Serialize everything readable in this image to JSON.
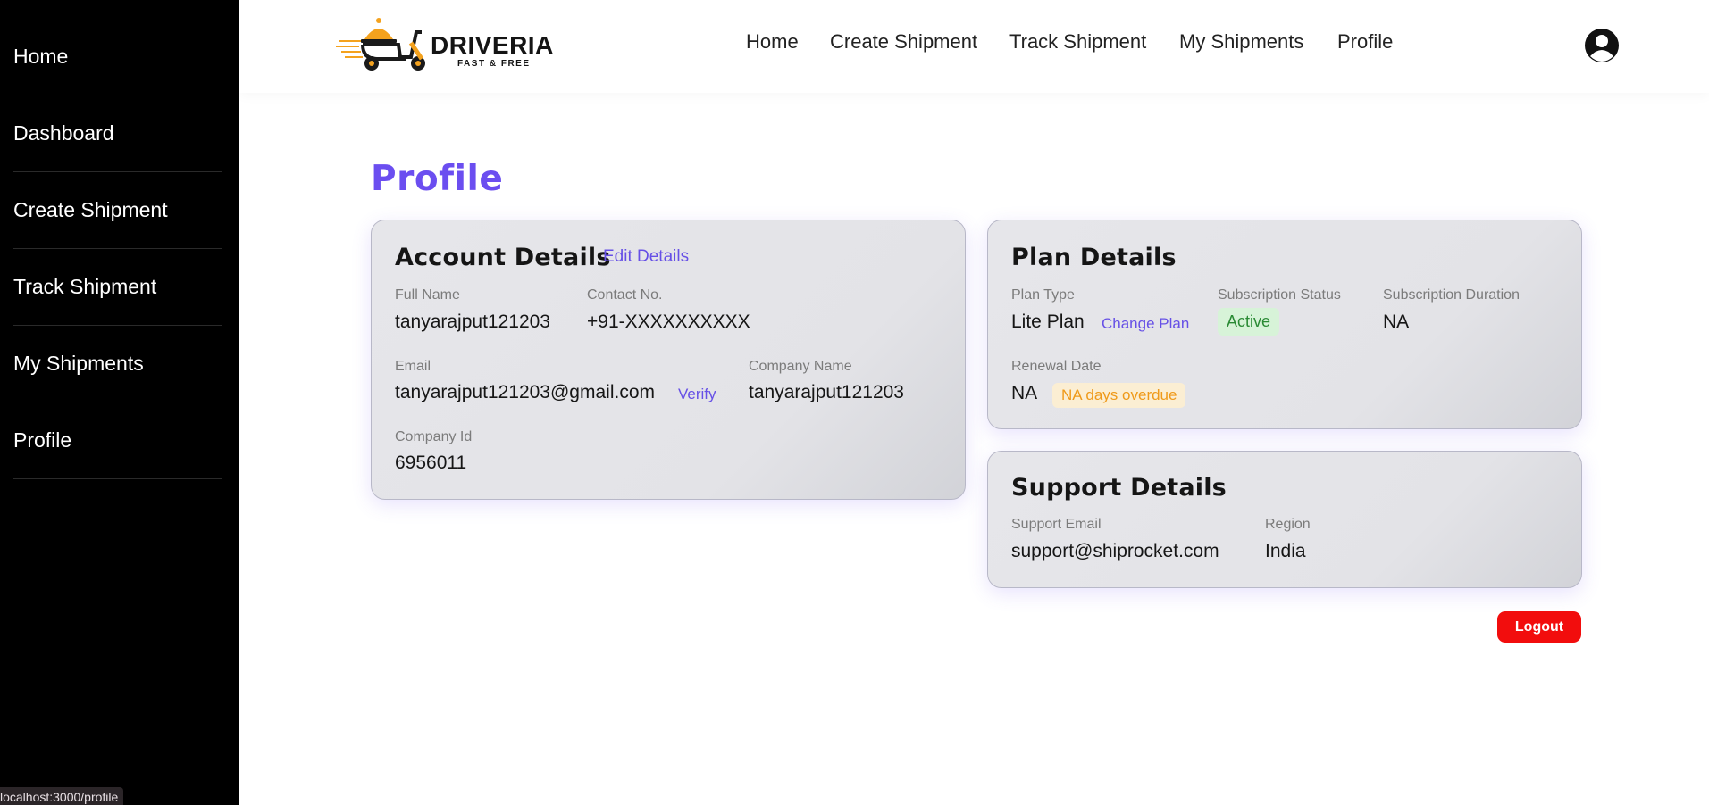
{
  "sidebar": {
    "items": [
      {
        "label": "Home"
      },
      {
        "label": "Dashboard"
      },
      {
        "label": "Create Shipment"
      },
      {
        "label": "Track Shipment"
      },
      {
        "label": "My Shipments"
      },
      {
        "label": "Profile"
      }
    ]
  },
  "status_bar": {
    "url": "localhost:3000/profile"
  },
  "header": {
    "logo": {
      "name": "DRIVERIA",
      "tagline": "FAST & FREE"
    },
    "nav": [
      {
        "label": "Home"
      },
      {
        "label": "Create Shipment"
      },
      {
        "label": "Track Shipment"
      },
      {
        "label": "My Shipments"
      },
      {
        "label": "Profile"
      }
    ],
    "user_icon": "user-circle-icon"
  },
  "page": {
    "title": "Profile"
  },
  "account": {
    "title": "Account Details",
    "edit_label": "Edit Details",
    "full_name_label": "Full Name",
    "full_name": "tanyarajput121203",
    "contact_label": "Contact No.",
    "contact": "+91-XXXXXXXXXX",
    "email_label": "Email",
    "email": "tanyarajput121203@gmail.com",
    "verify_label": "Verify",
    "company_name_label": "Company Name",
    "company_name": "tanyarajput121203",
    "company_id_label": "Company Id",
    "company_id": "6956011"
  },
  "plan": {
    "title": "Plan Details",
    "type_label": "Plan Type",
    "type": "Lite Plan",
    "change_label": "Change Plan",
    "status_label": "Subscription Status",
    "status": "Active",
    "duration_label": "Subscription Duration",
    "duration": "NA",
    "renewal_label": "Renewal Date",
    "renewal": "NA",
    "overdue": "NA days overdue"
  },
  "support": {
    "title": "Support Details",
    "email_label": "Support Email",
    "email": "support@shiprocket.com",
    "region_label": "Region",
    "region": "India"
  },
  "actions": {
    "logout_label": "Logout"
  },
  "colors": {
    "accent": "#6b4ef0",
    "logout": "#f20d0d",
    "active_badge_bg": "#d7f3d8",
    "overdue_badge_bg": "#fbeed3",
    "logo_orange": "#f4a21e"
  }
}
